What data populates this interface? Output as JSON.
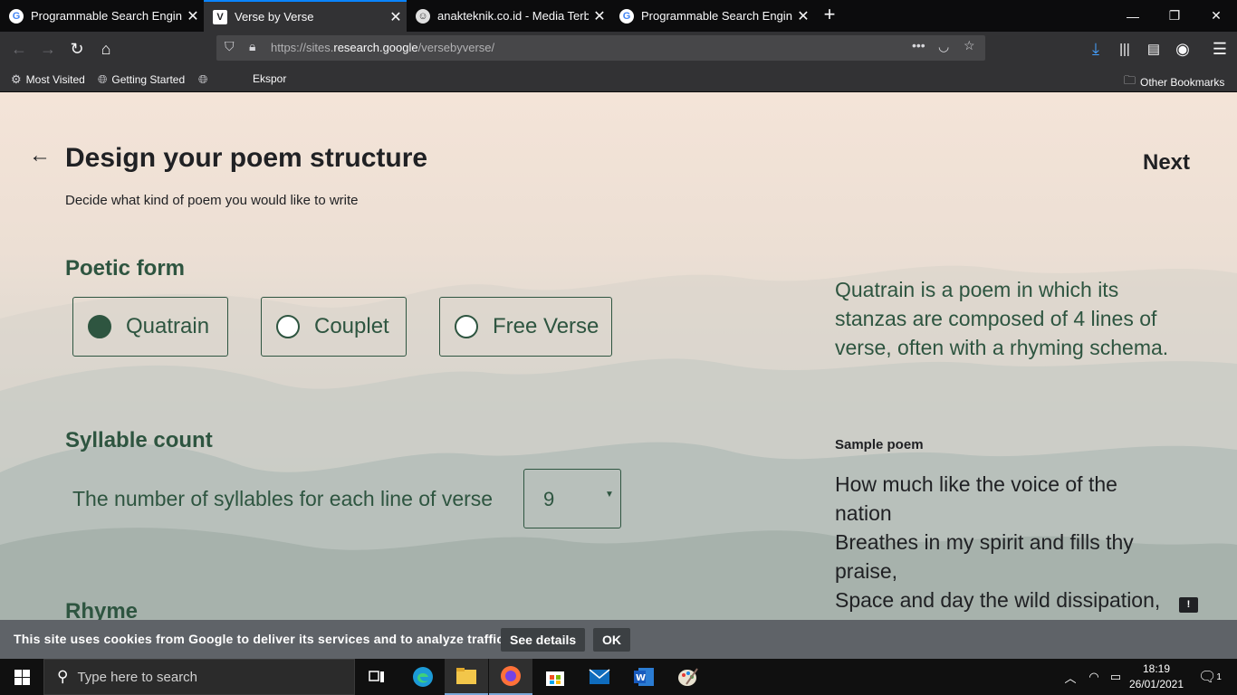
{
  "browser": {
    "tabs": [
      {
        "title": "Programmable Search Engine",
        "favicon": "google-g-icon",
        "active": false
      },
      {
        "title": "Verse by Verse",
        "favicon": "verse-v-icon",
        "active": true
      },
      {
        "title": "anakteknik.co.id - Media Terbe",
        "favicon": "anakteknik-icon",
        "active": false
      },
      {
        "title": "Programmable Search Engine",
        "favicon": "google-g-icon",
        "active": false
      }
    ],
    "url_prefix": "https://sites.",
    "url_domain": "research.google",
    "url_path": "/versebyverse/",
    "bookmarks": {
      "most_visited": "Most Visited",
      "getting_started": "Getting Started",
      "ekspor": "Ekspor",
      "other": "Other Bookmarks"
    }
  },
  "page": {
    "title": "Design your poem structure",
    "subtitle": "Decide what kind of poem you would like to write",
    "next_label": "Next",
    "poetic_form": {
      "heading": "Poetic form",
      "options": [
        {
          "label": "Quatrain",
          "selected": true
        },
        {
          "label": "Couplet",
          "selected": false
        },
        {
          "label": "Free Verse",
          "selected": false
        }
      ]
    },
    "syllable": {
      "heading": "Syllable count",
      "label": "The number of syllables for each line of verse",
      "value": "9"
    },
    "rhyme_heading": "Rhyme",
    "description": "Quatrain is a poem in which its stanzas are composed of 4 lines of verse, often with a rhyming schema.",
    "sample_heading": "Sample poem",
    "sample_lines": [
      "How much like the voice of the nation",
      "Breathes in my spirit and fills thy praise,",
      "Space and day the wild dissipation,"
    ],
    "feedback_icon": "!"
  },
  "cookie": {
    "text": "This site uses cookies from Google to deliver its services and to analyze traffic.",
    "details": "See details",
    "ok": "OK"
  },
  "taskbar": {
    "search_placeholder": "Type here to search",
    "time": "18:19",
    "date": "26/01/2021",
    "notification_count": "1"
  },
  "colors": {
    "accent_green": "#2e5540",
    "firefox_tab_highlight": "#0a84ff"
  }
}
